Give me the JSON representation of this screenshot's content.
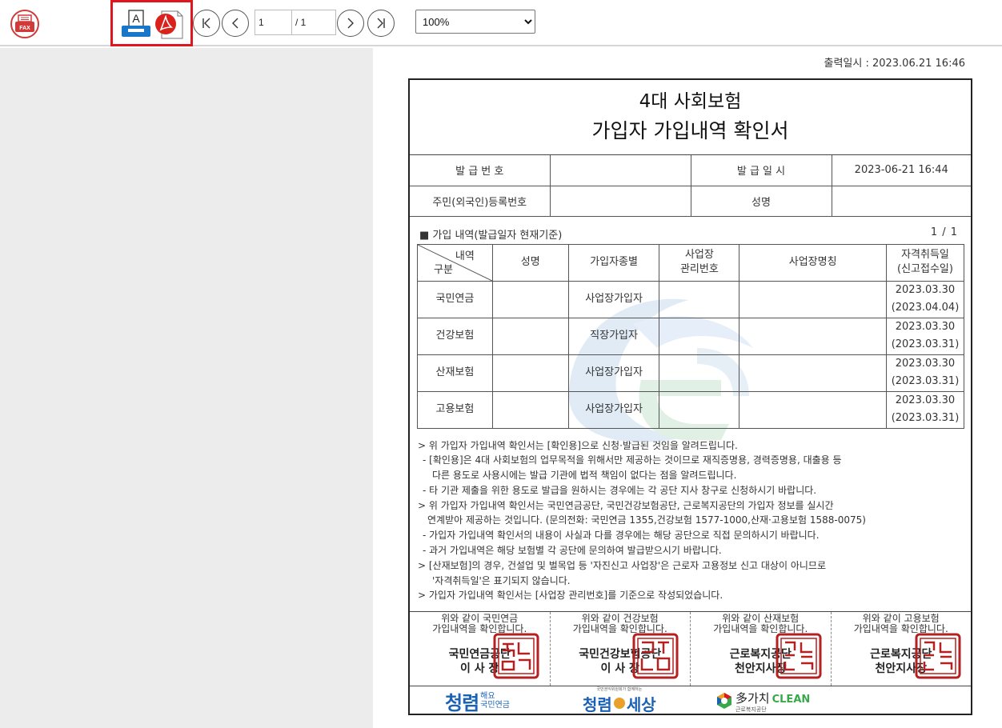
{
  "toolbar": {
    "page_current": "1",
    "page_total": "/ 1",
    "zoom_value": "100%",
    "zoom_options": [
      "100%"
    ],
    "pdf_text": "A"
  },
  "document": {
    "print_date": "출력일시 : 2023.06.21 16:46",
    "title_line1": "4대 사회보험",
    "title_line2": "가입자 가입내역 확인서",
    "info": {
      "issue_no_label": "발 급 번 호",
      "issue_no_value": "",
      "issue_date_label": "발 급 일 시",
      "issue_date_value": "2023-06-21 16:44",
      "reg_no_label": "주민(외국인)등록번호",
      "reg_no_value": "",
      "name_label": "성명",
      "name_value": ""
    },
    "section_title": "■ 가입 내역(발급일자 현재기준)",
    "section_page": "1 / 1",
    "table": {
      "diag_top": "내역",
      "diag_bottom": "구분",
      "headers": [
        "성명",
        "가입자종별",
        "사업장\n관리번호",
        "사업장명칭",
        "자격취득일\n(신고접수일)"
      ],
      "rows": [
        {
          "type": "국민연금",
          "name": "",
          "kind": "사업장가입자",
          "biz_no": "",
          "biz_name": "",
          "date": "2023.03.30",
          "date2": "(2023.04.04)"
        },
        {
          "type": "건강보험",
          "name": "",
          "kind": "직장가입자",
          "biz_no": "",
          "biz_name": "",
          "date": "2023.03.30",
          "date2": "(2023.03.31)"
        },
        {
          "type": "산재보험",
          "name": "",
          "kind": "사업장가입자",
          "biz_no": "",
          "biz_name": "",
          "date": "2023.03.30",
          "date2": "(2023.03.31)"
        },
        {
          "type": "고용보험",
          "name": "",
          "kind": "사업장가입자",
          "biz_no": "",
          "biz_name": "",
          "date": "2023.03.30",
          "date2": "(2023.03.31)"
        }
      ]
    },
    "notes": [
      "> 위 가입자 가입내역 확인서는 [확인용]으로 신청·발급된 것임을 알려드립니다.",
      "- [확인용]은 4대 사회보험의 업무목적을 위해서만 제공하는 것이므로 재직증명용, 경력증명용, 대출용 등",
      "다른 용도로 사용시에는 발급 기관에 법적 책임이 없다는 점을 알려드립니다.",
      "- 타 기관 제출을 위한 용도로 발급을 원하시는 경우에는 각 공단 지사 창구로 신청하시기 바랍니다.",
      "> 위 가입자 가입내역 확인서는 국민연금공단, 국민건강보험공단, 근로복지공단의 가입자 정보를 실시간",
      "연계받아 제공하는 것입니다. (문의전화: 국민연금 1355,건강보험 1577-1000,산재·고용보험 1588-0075)",
      "- 가입자 가입내역 확인서의 내용이 사실과 다를 경우에는 해당 공단으로 직접 문의하시기 바랍니다.",
      "- 과거 가입내역은 해당 보험별 각 공단에 문의하여 발급받으시기 바랍니다.",
      "> [산재보험]의 경우, 건설업 및 벌목업 등 '자진신고 사업장'은 근로자 고용정보 신고 대상이 아니므로",
      "'자격취득일'은 표기되지 않습니다.",
      "> 가입자 가입내역 확인서는 [사업장 관리번호]를 기준으로 작성되었습니다."
    ],
    "stamps": [
      {
        "line1": "위와 같이 국민연금",
        "line2": "가입내역을 확인합니다.",
        "org1": "국민연금공단",
        "org2": "이 사 장"
      },
      {
        "line1": "위와 같이 건강보험",
        "line2": "가입내역을 확인합니다.",
        "org1": "국민건강보험공단",
        "org2": "이 사 장"
      },
      {
        "line1": "위와 같이 산재보험",
        "line2": "가입내역을 확인합니다.",
        "org1": "근로복지공단",
        "org2": "천안지사장"
      },
      {
        "line1": "위와 같이 고용보험",
        "line2": "가입내역을 확인합니다.",
        "org1": "근로복지공단",
        "org2": "천안지사장"
      }
    ],
    "logos": {
      "logo1_a": "청렴",
      "logo1_b": "해요",
      "logo1_c": "국민연금",
      "logo2_top": "국민권익위원회가 함께하는",
      "logo2_main": "청렴",
      "logo2_end": "세상",
      "logo3_main": "多가치",
      "logo3_clean": "CLEAN",
      "logo3_sub": "근로복지공단"
    }
  },
  "colors": {
    "highlight": "#e0161f",
    "fax_red": "#d23a3a",
    "pdf_red": "#d9221c",
    "printer_blue": "#1976c9",
    "seal_red": "#b52020",
    "logo_blue": "#1b62b5"
  }
}
